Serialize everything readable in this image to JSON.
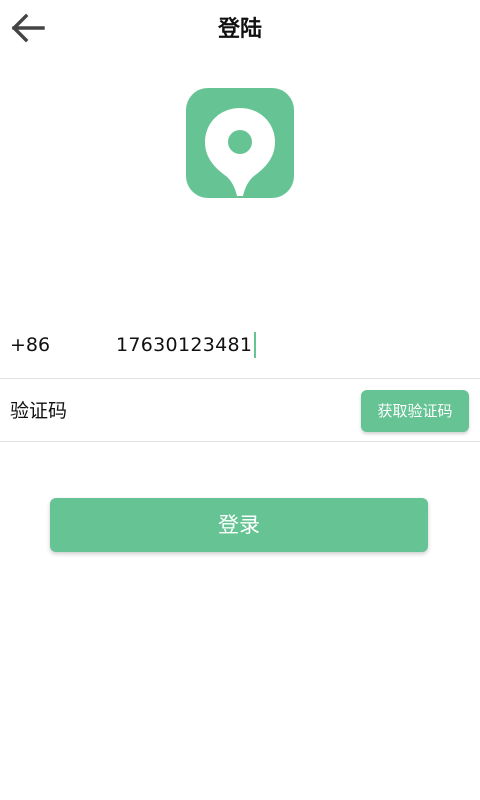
{
  "theme": {
    "accent": "#66c394"
  },
  "header": {
    "title": "登陆",
    "back_icon": "arrow-left-icon"
  },
  "logo": {
    "icon": "location-pin-icon"
  },
  "phone": {
    "country_code": "+86",
    "value": "17630123481"
  },
  "code": {
    "placeholder": "验证码",
    "get_code_label": "获取验证码"
  },
  "actions": {
    "login_label": "登录"
  }
}
